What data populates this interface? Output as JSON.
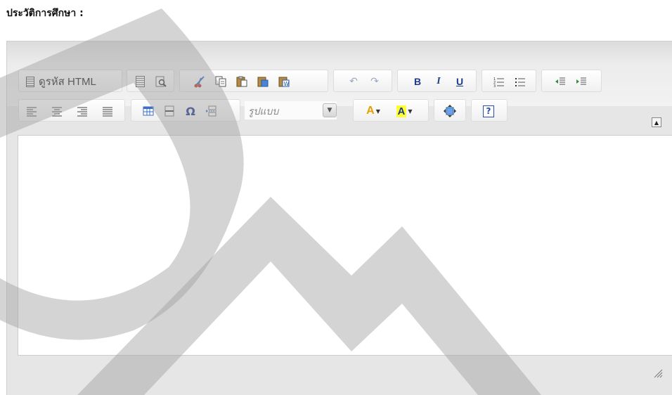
{
  "section": {
    "title": "ประวัติการศึกษา :"
  },
  "toolbar": {
    "source_label": "ดูรหัส HTML",
    "format_combo": {
      "placeholder": "รูปแบบ"
    },
    "icons": {
      "source": "source-icon",
      "templates": "templates-icon",
      "preview": "preview-icon",
      "cut": "scissors-icon",
      "copy": "copy-icon",
      "paste": "paste-icon",
      "paste_text": "paste-text-icon",
      "paste_word": "paste-word-icon",
      "undo": "undo-icon",
      "redo": "redo-icon",
      "bold": "bold-icon",
      "italic": "italic-icon",
      "underline": "underline-icon",
      "numbered_list": "numbered-list-icon",
      "bulleted_list": "bulleted-list-icon",
      "outdent": "outdent-icon",
      "indent": "indent-icon",
      "align_left": "align-left-icon",
      "align_center": "align-center-icon",
      "align_right": "align-right-icon",
      "justify": "justify-icon",
      "table": "table-icon",
      "horizontal_rule": "horizontal-rule-icon",
      "special_char": "omega-icon",
      "page_break": "page-break-icon",
      "text_color": "text-color-icon",
      "bg_color": "background-color-icon",
      "maximize": "maximize-icon",
      "about": "help-icon"
    },
    "glyphs": {
      "bold": "B",
      "italic": "I",
      "underline": "U",
      "omega": "Ω",
      "help": "?",
      "text_color": "A",
      "bg_color": "A"
    }
  },
  "colors": {
    "editor_frame": "#e6e6e6",
    "text_color_accent": "#e8a000",
    "bg_color_accent": "#ffff33",
    "help_icon": "#2b4fa8",
    "bold_underline": "#1c3b8c"
  }
}
